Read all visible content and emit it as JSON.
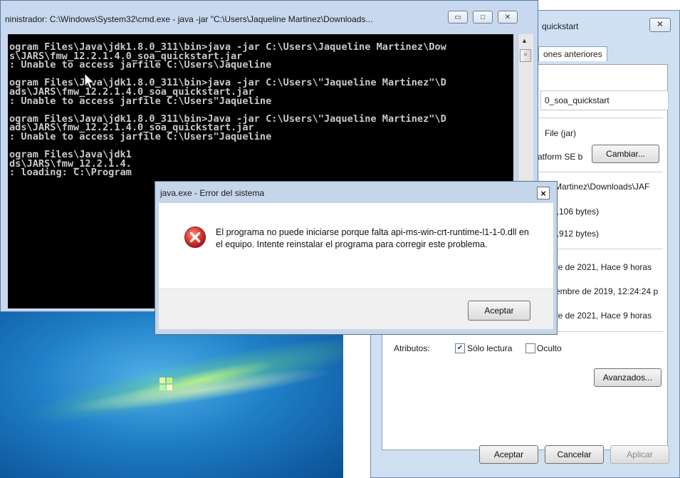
{
  "cmd": {
    "title": "ninistrador: C:\\Windows\\System32\\cmd.exe - java  -jar \"C:\\Users\\Jaqueline Martinez\\Downloads...",
    "lines": [
      "ogram Files\\Java\\jdk1.8.0_311\\bin>java -jar C:\\Users\\Jaqueline Martinez\\Dow",
      "s\\JARS\\fmw_12.2.1.4.0_soa_quickstart.jar",
      ": Unable to access jarfile C:\\Users\\Jaqueline",
      "",
      "ogram Files\\Java\\jdk1.8.0_311\\bin>java -jar C:\\Users\\\"Jaqueline Martinez\"\\D",
      "ads\\JARS\\fmw_12.2.1.4.0_soa_quickstart.jar",
      ": Unable to access jarfile C:\\Users\"Jaqueline",
      "",
      "ogram Files\\Java\\jdk1.8.0_311\\bin>Java -jar C:\\Users\\\"Jaqueline Martinez\"\\D",
      "ads\\JARS\\fmw_12.2.1.4.0_soa_quickstart.jar",
      ": Unable to access jarfile C:\\Users\"Jaqueline",
      "",
      "ogram Files\\Java\\jdk1",
      "ds\\JARS\\fmw_12.2.1.4.",
      ": loading: C:\\Program"
    ]
  },
  "error_dialog": {
    "title": "java.exe - Error del sistema",
    "close_label": "×",
    "message": "El programa no puede iniciarse porque falta api-ms-win-crt-runtime-l1-1-0.dll en el equipo. Intente reinstalar el programa para corregir este problema.",
    "ok_label": "Aceptar"
  },
  "props": {
    "title": "quickstart",
    "close_label": "✕",
    "tab_label": "ones anteriores",
    "name_value": "0_soa_quickstart",
    "type_value": "File (jar)",
    "opens_with": "atform SE b",
    "change_label": "Cambiar...",
    "location": "e Martinez\\Downloads\\JAF",
    "size": "2,106 bytes)",
    "size_on_disk": "4,912 bytes)",
    "created": "bre de 2021, Hace 9 horas",
    "modified": "tiembre de 2019, 12:24:24 p",
    "accessed": "bre de 2021, Hace 9 horas",
    "attributes_label": "Atributos:",
    "readonly_label": "Sólo lectura",
    "hidden_label": "Oculto",
    "advanced_label": "Avanzados...",
    "ok_label": "Aceptar",
    "cancel_label": "Cancelar",
    "apply_label": "Aplicar"
  },
  "colors": {
    "error_icon": "#d9302a",
    "console_bg": "#000000",
    "console_text": "#c9c9c9"
  }
}
